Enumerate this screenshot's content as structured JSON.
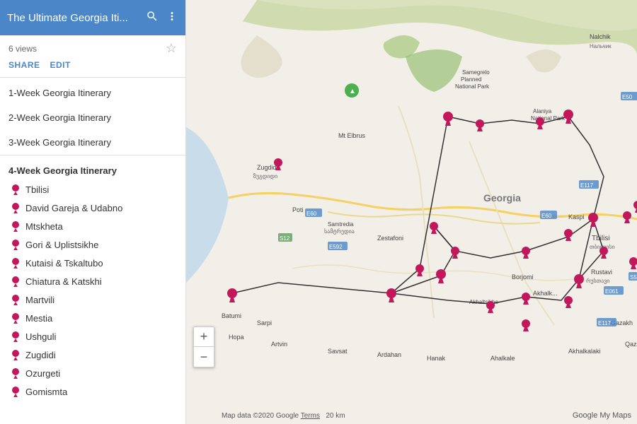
{
  "header": {
    "title": "The Ultimate Georgia Iti...",
    "bg_color": "#4a86c8"
  },
  "meta": {
    "views": "6 views",
    "share_label": "SHARE",
    "edit_label": "EDIT"
  },
  "sidebar": {
    "sections": [
      {
        "id": "s1",
        "label": "1-Week Georgia Itinerary",
        "type": "section"
      },
      {
        "id": "s2",
        "label": "2-Week Georgia Itinerary",
        "type": "section"
      },
      {
        "id": "s3",
        "label": "3-Week Georgia Itinerary",
        "type": "section"
      },
      {
        "id": "s4",
        "label": "4-Week Georgia Itinerary",
        "type": "header"
      }
    ],
    "places": [
      "Tbilisi",
      "David Gareja & Udabno",
      "Mtskheta",
      "Gori & Uplistsikhe",
      "Kutaisi & Tskaltubo",
      "Chiatura & Katskhi",
      "Martvili",
      "Mestia",
      "Ushguli",
      "Zugdidi",
      "Ozurgeti",
      "Gomismta"
    ]
  },
  "zoom": {
    "in_label": "+",
    "out_label": "−"
  },
  "attribution": {
    "map_data": "Map data ©2020 Google",
    "terms": "Terms",
    "distance": "20 km",
    "google_my_maps": "Google My Maps"
  }
}
